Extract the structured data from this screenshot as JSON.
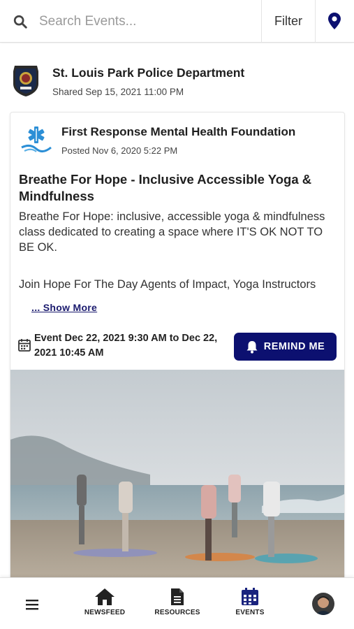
{
  "search": {
    "placeholder": "Search Events...",
    "filter_label": "Filter"
  },
  "share": {
    "department": "St. Louis Park Police Department",
    "shared_date": "Shared Sep 15, 2021 11:00 PM"
  },
  "post": {
    "organization": "First Response Mental Health Foundation",
    "posted_date": "Posted Nov 6, 2020 5:22 PM",
    "title": "Breathe For Hope - Inclusive Accessible Yoga & Mindfulness",
    "description": "Breathe For Hope: inclusive, accessible yoga & mindfulness class dedicated to creating a space where IT'S OK NOT TO BE OK.",
    "description_2": "Join Hope For The Day Agents of Impact, Yoga Instructors",
    "show_more": "... Show More",
    "event_time": "Event Dec 22, 2021 9:30 AM to Dec 22, 2021 10:45 AM",
    "remind_label": "REMIND ME"
  },
  "nav": {
    "items": [
      {
        "label": "NEWSFEED",
        "icon": "home-icon"
      },
      {
        "label": "RESOURCES",
        "icon": "document-icon"
      },
      {
        "label": "EVENTS",
        "icon": "calendar-icon"
      }
    ]
  },
  "colors": {
    "accent": "#0c1070",
    "nav_active": "#1a237e"
  }
}
